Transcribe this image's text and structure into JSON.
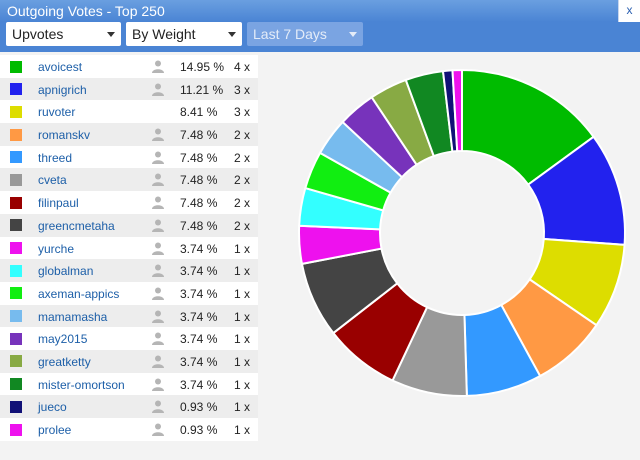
{
  "window": {
    "title": "Outgoing Votes - Top 250",
    "close_label": "x"
  },
  "toolbar": {
    "vote_type": "Upvotes",
    "sort_by": "By Weight",
    "period": "Last 7 Days"
  },
  "chart_data": {
    "type": "pie",
    "donut": true,
    "categories": [
      "avoicest",
      "apnigrich",
      "ruvoter",
      "romanskv",
      "threed",
      "cveta",
      "filinpaul",
      "greencmetaha",
      "yurche",
      "globalman",
      "axeman-appics",
      "mamamasha",
      "may2015",
      "greatketty",
      "mister-omortson",
      "jueco",
      "prolee"
    ],
    "values": [
      14.95,
      11.21,
      8.41,
      7.48,
      7.48,
      7.48,
      7.48,
      7.48,
      3.74,
      3.74,
      3.74,
      3.74,
      3.74,
      3.74,
      3.74,
      0.93,
      0.93
    ],
    "colors": [
      "#00bb00",
      "#2222ee",
      "#dddd00",
      "#ff9944",
      "#3399ff",
      "#999999",
      "#990000",
      "#444444",
      "#ee11ee",
      "#33ffff",
      "#11ee11",
      "#77bbee",
      "#7733bb",
      "#88aa44",
      "#118822",
      "#111177",
      "#ee11ee"
    ]
  },
  "rows": [
    {
      "name": "avoicest",
      "pct": "14.95 %",
      "count": "4 x",
      "color": "#00bb00",
      "icon": "person-icon"
    },
    {
      "name": "apnigrich",
      "pct": "11.21 %",
      "count": "3 x",
      "color": "#2222ee",
      "icon": "person-icon"
    },
    {
      "name": "ruvoter",
      "pct": "8.41 %",
      "count": "3 x",
      "color": "#dddd00",
      "icon": ""
    },
    {
      "name": "romanskv",
      "pct": "7.48 %",
      "count": "2 x",
      "color": "#ff9944",
      "icon": "person-icon"
    },
    {
      "name": "threed",
      "pct": "7.48 %",
      "count": "2 x",
      "color": "#3399ff",
      "icon": "person-icon"
    },
    {
      "name": "cveta",
      "pct": "7.48 %",
      "count": "2 x",
      "color": "#999999",
      "icon": "person-icon"
    },
    {
      "name": "filinpaul",
      "pct": "7.48 %",
      "count": "2 x",
      "color": "#990000",
      "icon": "person-icon"
    },
    {
      "name": "greencmetaha",
      "pct": "7.48 %",
      "count": "2 x",
      "color": "#444444",
      "icon": "person-icon"
    },
    {
      "name": "yurche",
      "pct": "3.74 %",
      "count": "1 x",
      "color": "#ee11ee",
      "icon": "person-icon"
    },
    {
      "name": "globalman",
      "pct": "3.74 %",
      "count": "1 x",
      "color": "#33ffff",
      "icon": "person-icon"
    },
    {
      "name": "axeman-appics",
      "pct": "3.74 %",
      "count": "1 x",
      "color": "#11ee11",
      "icon": "person-icon"
    },
    {
      "name": "mamamasha",
      "pct": "3.74 %",
      "count": "1 x",
      "color": "#77bbee",
      "icon": "person-icon"
    },
    {
      "name": "may2015",
      "pct": "3.74 %",
      "count": "1 x",
      "color": "#7733bb",
      "icon": "person-icon"
    },
    {
      "name": "greatketty",
      "pct": "3.74 %",
      "count": "1 x",
      "color": "#88aa44",
      "icon": "person-icon"
    },
    {
      "name": "mister-omortson",
      "pct": "3.74 %",
      "count": "1 x",
      "color": "#118822",
      "icon": "person-icon"
    },
    {
      "name": "jueco",
      "pct": "0.93 %",
      "count": "1 x",
      "color": "#111177",
      "icon": "person-icon"
    },
    {
      "name": "prolee",
      "pct": "0.93 %",
      "count": "1 x",
      "color": "#ee11ee",
      "icon": "person-icon"
    }
  ]
}
